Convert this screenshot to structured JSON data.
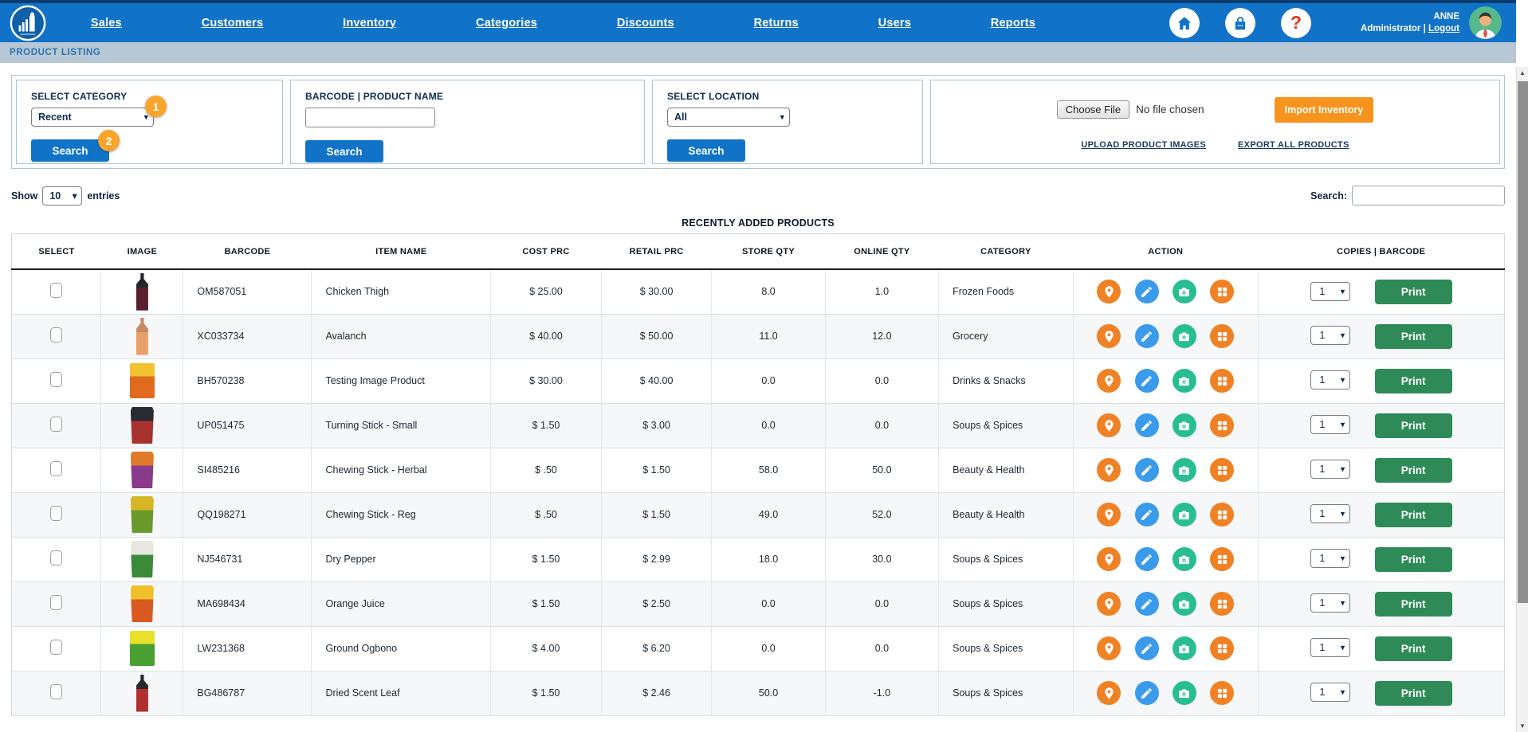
{
  "nav": {
    "items": [
      "Sales",
      "Customers",
      "Inventory",
      "Categories",
      "Discounts",
      "Returns",
      "Users",
      "Reports"
    ],
    "icons": [
      "home-icon",
      "lock-icon",
      "help-icon"
    ],
    "help_glyph": "?",
    "user": {
      "name": "ANNE",
      "role": "Administrator",
      "separator": "|",
      "logout": "Logout"
    }
  },
  "breadcrumb": "PRODUCT LISTING",
  "filters": {
    "category": {
      "label": "SELECT CATEGORY",
      "selected": "Recent",
      "search_label": "Search",
      "badge_step1": "1",
      "badge_step2": "2"
    },
    "product": {
      "label": "BARCODE | PRODUCT NAME",
      "value": "",
      "search_label": "Search"
    },
    "location": {
      "label": "SELECT LOCATION",
      "selected": "All",
      "search_label": "Search"
    },
    "import": {
      "choose_file_label": "Choose File",
      "file_status": "No file chosen",
      "import_label": "Import Inventory",
      "upload_images_link": "UPLOAD PRODUCT IMAGES",
      "export_products_link": "EXPORT ALL PRODUCTS"
    }
  },
  "list_controls": {
    "show_label": "Show",
    "page_size": "10",
    "entries_label": "entries",
    "search_label": "Search:",
    "search_value": ""
  },
  "table": {
    "title": "RECENTLY ADDED PRODUCTS",
    "columns": [
      "SELECT",
      "IMAGE",
      "BARCODE",
      "ITEM NAME",
      "COST PRC",
      "RETAIL PRC",
      "STORE QTY",
      "ONLINE QTY",
      "CATEGORY",
      "ACTION",
      "COPIES | BARCODE"
    ],
    "action_icons": [
      "location-pin-icon",
      "edit-pencil-icon",
      "camera-icon",
      "barcode-grid-icon"
    ],
    "copies_value": "1",
    "print_label": "Print",
    "rows": [
      {
        "barcode": "OM587051",
        "item_name": "Chicken Thigh",
        "cost": "$ 25.00",
        "retail": "$ 30.00",
        "store_qty": "8.0",
        "online_qty": "1.0",
        "category": "Frozen Foods",
        "img": {
          "shape": "bottle",
          "top": "#23252d",
          "bottom": "#5a1f2e"
        }
      },
      {
        "barcode": "XC033734",
        "item_name": "Avalanch",
        "cost": "$ 40.00",
        "retail": "$ 50.00",
        "store_qty": "11.0",
        "online_qty": "12.0",
        "category": "Grocery",
        "img": {
          "shape": "bottle",
          "top": "#c98a62",
          "bottom": "#e8a06a"
        }
      },
      {
        "barcode": "BH570238",
        "item_name": "Testing Image Product",
        "cost": "$ 30.00",
        "retail": "$ 40.00",
        "store_qty": "0.0",
        "online_qty": "0.0",
        "category": "Drinks & Snacks",
        "img": {
          "shape": "box",
          "top": "#f2c231",
          "bottom": "#e06a1e"
        }
      },
      {
        "barcode": "UP051475",
        "item_name": "Turning Stick - Small",
        "cost": "$ 1.50",
        "retail": "$ 3.00",
        "store_qty": "0.0",
        "online_qty": "0.0",
        "category": "Soups & Spices",
        "img": {
          "shape": "packet",
          "top": "#2a2a32",
          "bottom": "#a8322e"
        }
      },
      {
        "barcode": "SI485216",
        "item_name": "Chewing Stick - Herbal",
        "cost": "$ .50",
        "retail": "$ 1.50",
        "store_qty": "58.0",
        "online_qty": "50.0",
        "category": "Beauty & Health",
        "img": {
          "shape": "packet",
          "top": "#e07a28",
          "bottom": "#8a3a8a"
        }
      },
      {
        "barcode": "QQ198271",
        "item_name": "Chewing Stick - Reg",
        "cost": "$ .50",
        "retail": "$ 1.50",
        "store_qty": "49.0",
        "online_qty": "52.0",
        "category": "Beauty & Health",
        "img": {
          "shape": "packet",
          "top": "#d8b525",
          "bottom": "#6a9a2a"
        }
      },
      {
        "barcode": "NJ546731",
        "item_name": "Dry Pepper",
        "cost": "$ 1.50",
        "retail": "$ 2.99",
        "store_qty": "18.0",
        "online_qty": "30.0",
        "category": "Soups & Spices",
        "img": {
          "shape": "packet",
          "top": "#e8e8e0",
          "bottom": "#3a8a3a"
        }
      },
      {
        "barcode": "MA698434",
        "item_name": "Orange Juice",
        "cost": "$ 1.50",
        "retail": "$ 2.50",
        "store_qty": "0.0",
        "online_qty": "0.0",
        "category": "Soups & Spices",
        "img": {
          "shape": "packet",
          "top": "#f0c02a",
          "bottom": "#d85a20"
        }
      },
      {
        "barcode": "LW231368",
        "item_name": "Ground Ogbono",
        "cost": "$ 4.00",
        "retail": "$ 6.20",
        "store_qty": "0.0",
        "online_qty": "0.0",
        "category": "Soups & Spices",
        "img": {
          "shape": "box",
          "top": "#e8e02a",
          "bottom": "#48a030"
        }
      },
      {
        "barcode": "BG486787",
        "item_name": "Dried Scent Leaf",
        "cost": "$ 1.50",
        "retail": "$ 2.46",
        "store_qty": "50.0",
        "online_qty": "-1.0",
        "category": "Soups & Spices",
        "img": {
          "shape": "bottle",
          "top": "#26262c",
          "bottom": "#b03030"
        }
      }
    ]
  },
  "colors": {
    "nav_blue": "#1173c8",
    "breadcrumb_bg": "#b6c7d5",
    "badge_orange": "#f9a42a",
    "import_orange": "#f7941e",
    "print_green": "#2e8b57",
    "icon_orange": "#f08124",
    "icon_blue": "#3b9beb",
    "icon_green": "#29bd92"
  }
}
